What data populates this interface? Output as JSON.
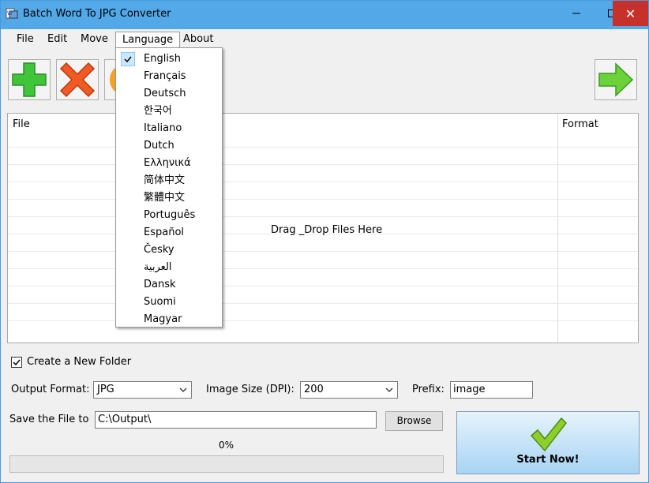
{
  "window": {
    "title": "Batch Word To JPG Converter",
    "controls": {
      "minimize": "—",
      "maximize": "☐",
      "close": "✕"
    }
  },
  "menu": {
    "file": "File",
    "edit": "Edit",
    "move": "Move",
    "language": "Language",
    "about": "About"
  },
  "toolbar": {
    "add_icon": "plus-icon",
    "remove_icon": "x-icon",
    "clear_icon": "refresh-icon",
    "next_icon": "arrow-right-icon",
    "colors": {
      "add": "#3fc43a",
      "remove": "#f15a22",
      "clear": "#f6a023",
      "next": "#6bd23a"
    }
  },
  "filelist": {
    "columns": [
      "File",
      "Format"
    ],
    "drop_hint": "Drag _Drop Files Here"
  },
  "options": {
    "new_folder_label": "Create a New Folder",
    "new_folder_checked": true,
    "output_format_label": "Output Format:",
    "output_format_value": "JPG",
    "image_size_label": "Image Size (DPI):",
    "image_size_value": "200",
    "prefix_label": "Prefix:",
    "prefix_value": "image",
    "save_label": "Save the File to",
    "save_path": "C:\\Output\\",
    "browse_label": "Browse"
  },
  "progress": {
    "label": "0%",
    "value": 0
  },
  "start": {
    "label": "Start Now!",
    "icon": "checkmark-icon"
  },
  "language_menu": {
    "selected": "English",
    "items": [
      "English",
      "Français",
      "Deutsch",
      "한국어",
      "Italiano",
      "Dutch",
      "Ελληνικά",
      "简体中文",
      "繁體中文",
      "Português",
      "Español",
      "Česky",
      "العربية",
      "Dansk",
      "Suomi",
      "Magyar"
    ]
  }
}
